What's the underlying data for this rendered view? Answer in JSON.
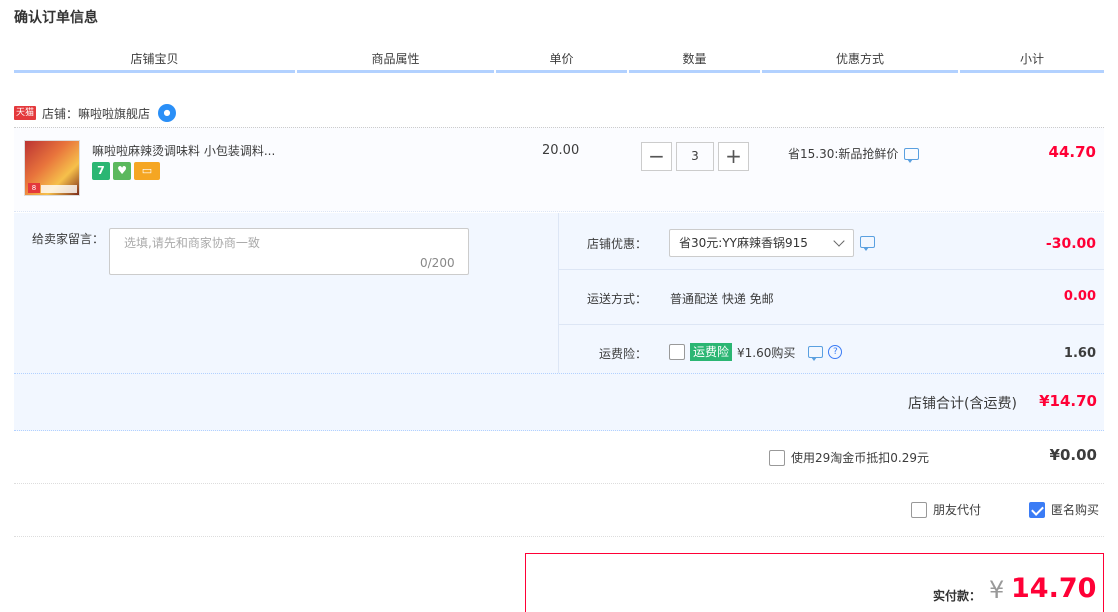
{
  "page": {
    "title": "确认订单信息"
  },
  "columns": [
    "店铺宝贝",
    "商品属性",
    "单价",
    "数量",
    "优惠方式",
    "小计"
  ],
  "shop": {
    "badge": "天猫",
    "label": "店铺：嘛啦啦旗舰店"
  },
  "item": {
    "name": "嘛啦啦麻辣烫调味料 小包装调料...",
    "thumb_badge": "8",
    "icon_7": "7",
    "icon_2": "♥",
    "icon_3": "▭",
    "price": "20.00",
    "qty_minus": "−",
    "qty_value": "3",
    "qty_plus": "+",
    "promo": "省15.30:新品抢鲜价",
    "subtotal": "44.70"
  },
  "message": {
    "label": "给卖家留言：",
    "placeholder": "选填,请先和商家协商一致",
    "counter": "0/200"
  },
  "discount": {
    "label": "店铺优惠：",
    "selected": "省30元:YY麻辣香锅915",
    "value": "-30.00"
  },
  "shipping": {
    "label": "运送方式：",
    "method": "普通配送 快递 免邮",
    "value": "0.00"
  },
  "insurance": {
    "label": "运费险：",
    "badge": "运费险",
    "price": "¥1.60购买",
    "help": "?",
    "value": "1.60"
  },
  "shop_total": {
    "label": "店铺合计(含运费)",
    "value": "¥14.70"
  },
  "coins": {
    "label": "使用29淘金币抵扣0.29元",
    "value": "¥0.00"
  },
  "options": {
    "friend_pay": "朋友代付",
    "anonymous": "匿名购买"
  },
  "payment": {
    "label": "实付款：",
    "currency": "¥",
    "amount": "14.70"
  },
  "colors": {
    "accent_red": "#ff0036",
    "header_line": "#b2d1ff",
    "panel_bg": "#f2f7ff",
    "checkbox_blue": "#3b7cf5"
  }
}
